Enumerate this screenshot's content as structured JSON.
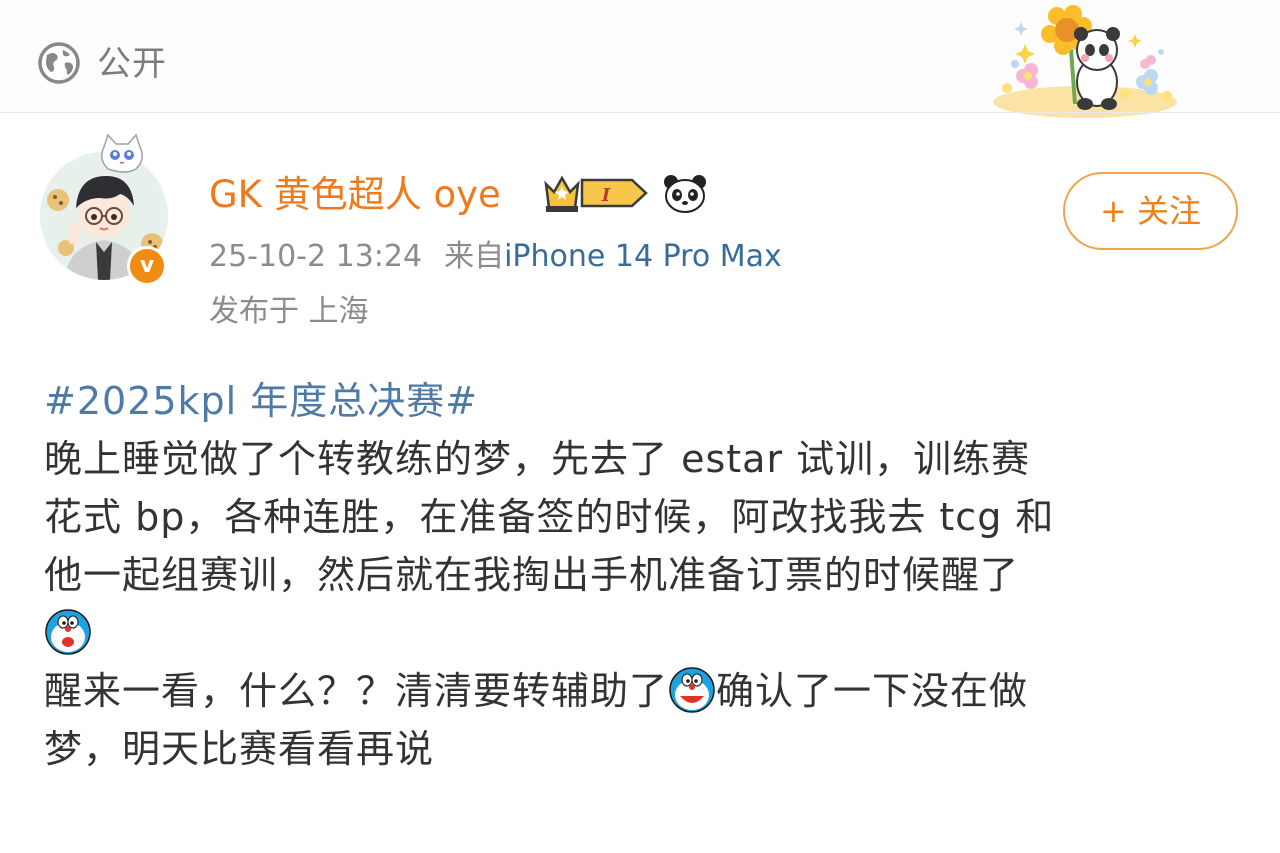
{
  "header": {
    "privacy_label": "公开",
    "privacy_icon": "globe-icon",
    "sticker": "panda-sunflower-sticker"
  },
  "author": {
    "name": "GK 黄色超人 oye",
    "level_badge": "I",
    "timestamp": "25-10-2 13:24",
    "source_prefix": "来自",
    "source_device": "iPhone 14 Pro Max",
    "location": "发布于 上海",
    "follow_label": "+ 关注",
    "colors": {
      "name": "#ee7a1c",
      "badge": "#f18c13",
      "link": "#3a6b99"
    }
  },
  "post": {
    "topic": "#2025kpl 年度总决赛#",
    "line1": "晚上睡觉做了个转教练的梦，先去了 estar 试训，训练赛",
    "line2": "花式 bp，各种连胜，在准备签的时候，阿改找我去 tcg 和",
    "line3": "他一起组赛训，然后就在我掏出手机准备订票的时候醒了",
    "line5a": "醒来一看，什么？？清清要转辅助了",
    "line5b": "确认了一下没在做",
    "line6": "梦，明天比赛看看再说",
    "emoji_name": "doraemon-emoji",
    "topic_color": "#4d7aa6"
  }
}
